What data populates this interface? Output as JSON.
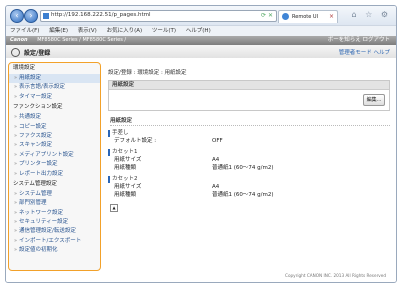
{
  "browser": {
    "url": "http://192.168.222.51/p_pages.html",
    "tab_label": "Remote UI",
    "menu": [
      "ファイル(F)",
      "編集(E)",
      "表示(V)",
      "お気に入り(A)",
      "ツール(T)",
      "ヘルプ(H)"
    ]
  },
  "canon": {
    "logo": "Canon",
    "model": "MF8580C Series / MF8580C Series /",
    "user": "ボーを知らえ ログアウト"
  },
  "header": {
    "title": "設定/登録",
    "manager": "管理者モード ヘルプ"
  },
  "sidebar": {
    "sections": [
      {
        "label": "環境設定",
        "items": [
          "用紙設定",
          "表示言語/表示設定",
          "タイマー設定"
        ]
      },
      {
        "label": "ファンクション設定",
        "items": [
          "共通設定",
          "コピー設定",
          "ファクス設定",
          "スキャン設定",
          "メディアプリント設定",
          "プリンター設定",
          "レポート出力設定"
        ]
      },
      {
        "label": "システム管理設定",
        "items": [
          "システム管理",
          "部門別管理",
          "ネットワーク設定",
          "セキュリティー設定",
          "通信管理設定/転送設定",
          "インポート/エクスポート",
          "設定値の初期化"
        ]
      }
    ]
  },
  "main": {
    "breadcrumb": "設定/登録 : 環境設定 : 用紙設定",
    "box_title": "用紙設定",
    "edit_label": "編集...",
    "section_title": "用紙設定",
    "groups": [
      {
        "title": "手差し",
        "rows": [
          {
            "label": "デフォルト設定 :",
            "value": "OFF"
          }
        ]
      },
      {
        "title": "カセット1",
        "rows": [
          {
            "label": "用紙サイズ",
            "value": "A4"
          },
          {
            "label": "用紙種類",
            "value": "普通紙1 (60〜74 g/m2)"
          }
        ]
      },
      {
        "title": "カセット2",
        "rows": [
          {
            "label": "用紙サイズ",
            "value": "A4"
          },
          {
            "label": "用紙種類",
            "value": "普通紙1 (60〜74 g/m2)"
          }
        ]
      }
    ],
    "footer": "Copyright CANON INC. 2013 All Rights Reserved"
  }
}
